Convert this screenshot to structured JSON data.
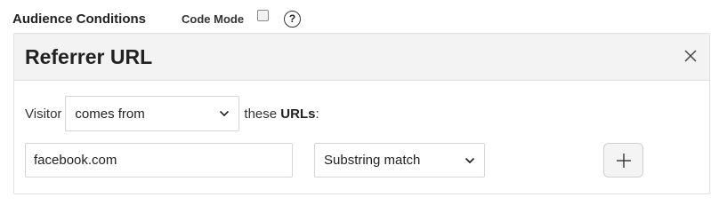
{
  "header": {
    "title": "Audience Conditions",
    "code_mode_label": "Code Mode",
    "code_mode_checked": false,
    "help_glyph": "?"
  },
  "panel": {
    "title": "Referrer URL",
    "close_icon": "close-icon",
    "sentence": {
      "prefix": "Visitor",
      "relation_selected": "comes from",
      "suffix_before": "these ",
      "suffix_bold": "URLs",
      "suffix_after": ":"
    },
    "url_condition": {
      "url_value": "facebook.com",
      "match_type_selected": "Substring match",
      "add_icon": "plus-icon"
    }
  }
}
